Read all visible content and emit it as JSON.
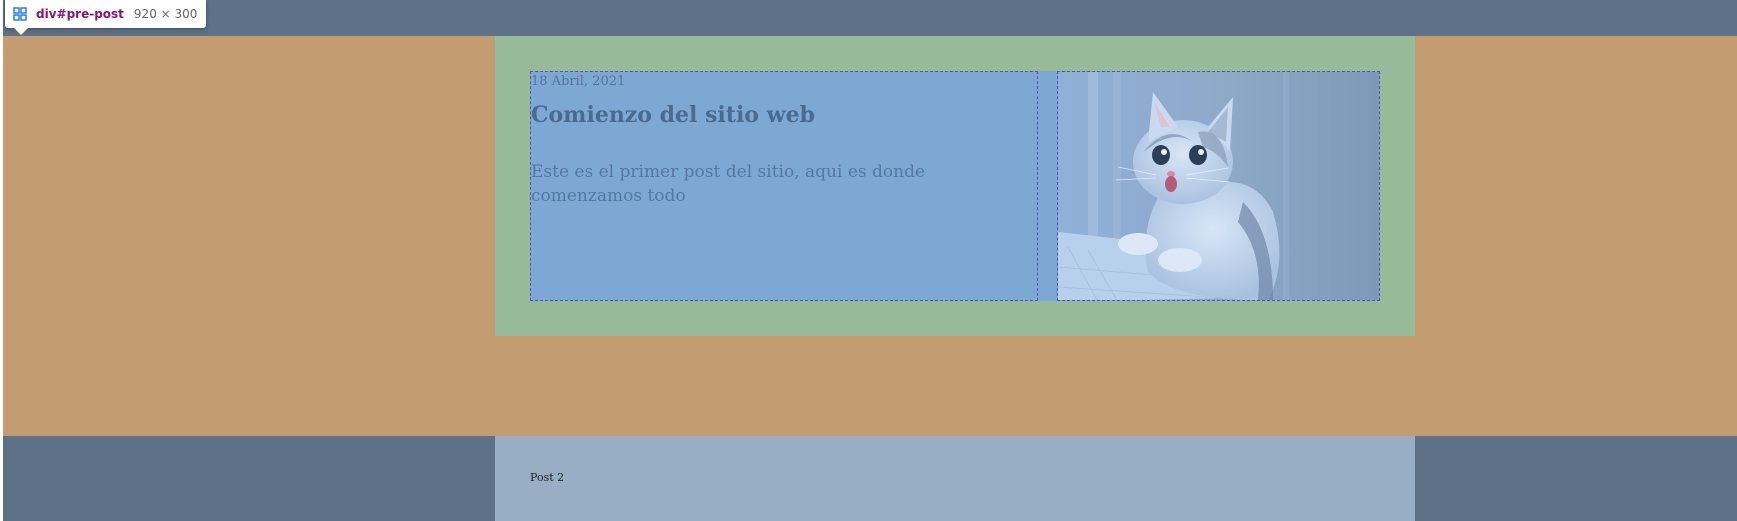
{
  "inspector_tooltip": {
    "selector": "div#pre-post",
    "dimensions": "920 × 300",
    "icon": "element-grid-icon"
  },
  "post": {
    "date": "18 Abril, 2021",
    "title": "Comienzo del sitio web",
    "excerpt": "Este es el primer post del sitio, aqui es donde comenzamos todo",
    "image": "cat-photo"
  },
  "next_post": {
    "label": "Post 2"
  },
  "colors": {
    "overlay_margin": "#c39c72",
    "overlay_padding": "#97ba99",
    "overlay_content": "#7ea8d4",
    "page_background": "#5e7287",
    "next_post_background": "#98aec4",
    "selector_color": "#881280"
  }
}
